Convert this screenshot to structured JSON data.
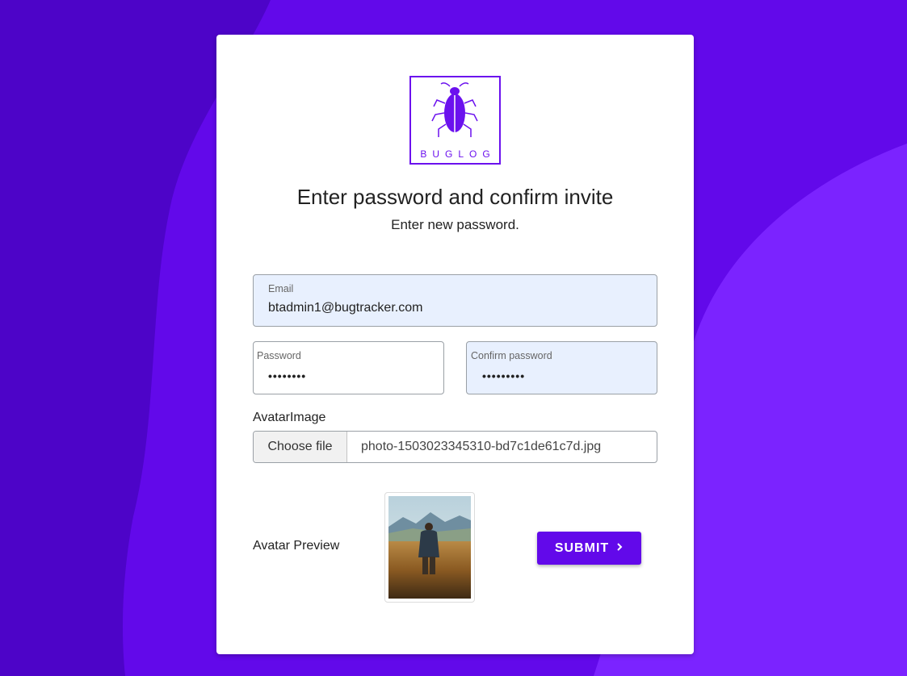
{
  "logo": {
    "text": "BUGLOG",
    "icon": "bug-icon"
  },
  "heading": {
    "title": "Enter password and confirm invite",
    "subtitle": "Enter new password."
  },
  "form": {
    "email": {
      "label": "Email",
      "value": "btadmin1@bugtracker.com"
    },
    "password": {
      "label": "Password",
      "value": "••••••••"
    },
    "confirm_password": {
      "label": "Confirm password",
      "value": "•••••••••"
    },
    "avatar": {
      "label": "AvatarImage",
      "button_label": "Choose file",
      "file_name": "photo-1503023345310-bd7c1de61c7d.jpg"
    },
    "preview": {
      "label": "Avatar Preview"
    },
    "submit": {
      "label": "SUBMIT",
      "icon": "chevron-right-icon"
    }
  },
  "colors": {
    "accent": "#6209ea",
    "background_dark": "#4d04c8",
    "background_light": "#7b23ff",
    "field_fill": "#e8f0fe"
  }
}
